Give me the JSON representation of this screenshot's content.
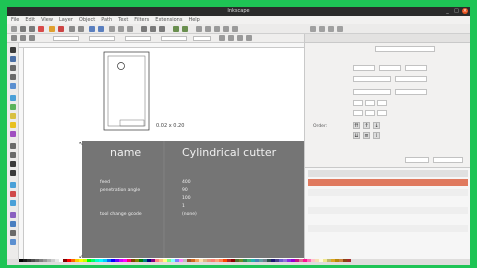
{
  "window": {
    "title": "Inkscape",
    "minimize": "_",
    "maximize": "□",
    "close": "×"
  },
  "menubar": {
    "items": [
      "File",
      "Edit",
      "View",
      "Layer",
      "Object",
      "Path",
      "Text",
      "Filters",
      "Extensions",
      "Help"
    ]
  },
  "canvas": {
    "small_label": "",
    "dims_label": "0.02 x 0.20",
    "table": {
      "heading_key": "name",
      "heading_value": "Cylindrical cutter",
      "rows": [
        {
          "key": "",
          "value": ""
        },
        {
          "key": "",
          "value": ""
        },
        {
          "key": "feed",
          "value": "400"
        },
        {
          "key": "penetration angle",
          "value": "90"
        },
        {
          "key": "",
          "value": "100"
        },
        {
          "key": "",
          "value": "1"
        },
        {
          "key": "tool change gcode",
          "value": "(none)"
        }
      ]
    }
  },
  "panel": {
    "tab_title": "",
    "fields": [
      {
        "label": "",
        "value": ""
      },
      {
        "label": "",
        "value": ""
      },
      {
        "label": "",
        "value": ""
      },
      {
        "label": "",
        "value": ""
      },
      {
        "label": "",
        "value": ""
      }
    ],
    "order_label": "Order:",
    "layers": {
      "header": "",
      "selected": "",
      "items": [
        "",
        "",
        "",
        "",
        "",
        ""
      ]
    }
  },
  "colors": {
    "desktop": "#1ec455",
    "accent": "#e95420",
    "table_bg": "#757575",
    "selected_layer": "#e07a5f"
  },
  "palette_colors": [
    "#000000",
    "#1a1a1a",
    "#333333",
    "#4d4d4d",
    "#666666",
    "#808080",
    "#999999",
    "#b3b3b3",
    "#cccccc",
    "#e6e6e6",
    "#ffffff",
    "#800000",
    "#ff0000",
    "#ff6600",
    "#ffcc00",
    "#ffff00",
    "#ccff00",
    "#00ff00",
    "#00ff66",
    "#00ffcc",
    "#00ffff",
    "#00ccff",
    "#0066ff",
    "#0000ff",
    "#6600ff",
    "#cc00ff",
    "#ff00ff",
    "#ff0066",
    "#804000",
    "#808000",
    "#008000",
    "#008080",
    "#000080",
    "#800080",
    "#ff8080",
    "#ffbf80",
    "#ffff80",
    "#80ff80",
    "#80ffff",
    "#8080ff",
    "#ff80ff",
    "#c0c0c0",
    "#a0522d",
    "#d2691e",
    "#f4a460",
    "#ffdead",
    "#deb887",
    "#e9967a",
    "#fa8072",
    "#ffa07a",
    "#ff7f50",
    "#ff4500",
    "#b22222",
    "#8b0000",
    "#556b2f",
    "#6b8e23",
    "#2e8b57",
    "#3cb371",
    "#20b2aa",
    "#4682b4",
    "#5f9ea0",
    "#708090",
    "#2f4f4f",
    "#191970",
    "#483d8b",
    "#6a5acd",
    "#9370db",
    "#8a2be2",
    "#9400d3",
    "#c71585",
    "#db7093",
    "#ff1493",
    "#ff69b4",
    "#ffc0cb",
    "#f5deb3",
    "#fff8dc",
    "#f0e68c",
    "#bdb76b",
    "#daa520",
    "#b8860b",
    "#cd853f",
    "#8b4513",
    "#a52a2a"
  ]
}
